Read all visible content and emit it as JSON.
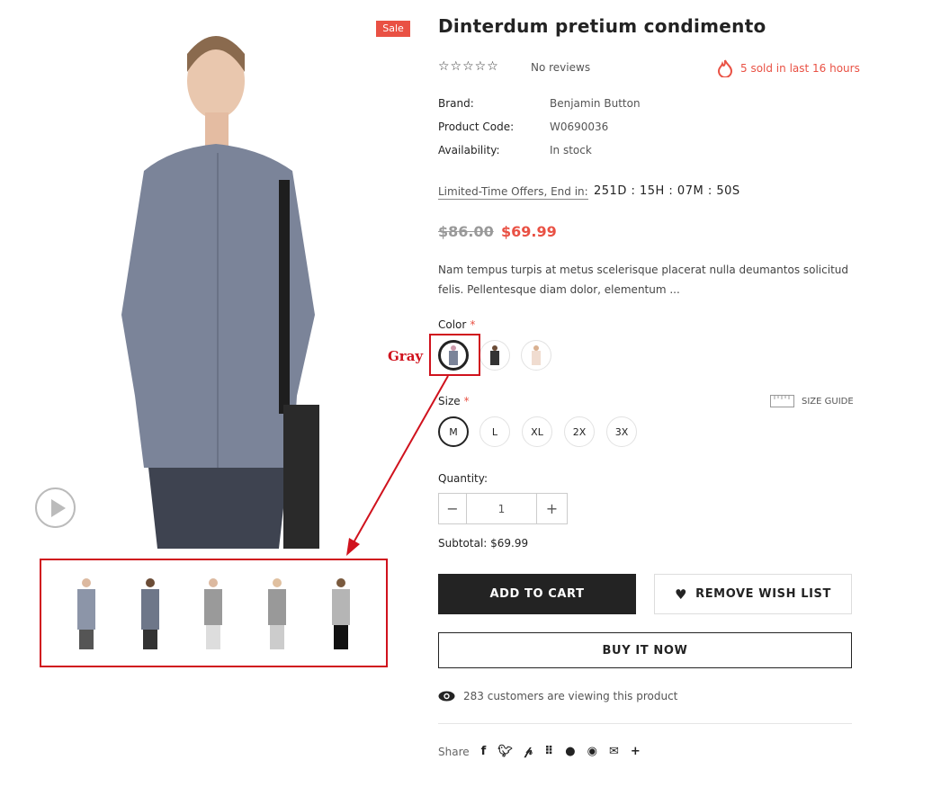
{
  "badge": "Sale",
  "product": {
    "title": "Dinterdum pretium condimento",
    "stars": "☆☆☆☆☆",
    "reviews": "No reviews",
    "sold": "5 sold in last 16 hours",
    "brand_label": "Brand:",
    "brand": "Benjamin Button",
    "code_label": "Product Code:",
    "code": "W0690036",
    "availability_label": "Availability:",
    "availability": "In stock",
    "offer_label": "Limited-Time Offers, End in:",
    "countdown": "251D : 15H : 07M : 50S",
    "old_price": "$86.00",
    "price": "$69.99",
    "description": "Nam tempus turpis at metus scelerisque placerat nulla deumantos solicitud felis. Pellentesque diam dolor, elementum ..."
  },
  "color": {
    "label": "Color",
    "required": "*",
    "selected_annotation": "Gray"
  },
  "size": {
    "label": "Size",
    "required": "*",
    "guide": "SIZE GUIDE",
    "options": [
      "M",
      "L",
      "XL",
      "2X",
      "3X"
    ],
    "selected": "M"
  },
  "quantity": {
    "label": "Quantity:",
    "value": "1",
    "minus": "−",
    "plus": "+"
  },
  "subtotal": {
    "label": "Subtotal:",
    "value": "$69.99"
  },
  "buttons": {
    "add_to_cart": "ADD TO CART",
    "wishlist": "REMOVE WISH LIST",
    "buy_now": "BUY IT NOW"
  },
  "viewers": "283 customers are viewing this product",
  "share": {
    "label": "Share",
    "icons": [
      "facebook-icon",
      "twitter-icon",
      "pinterest-icon",
      "grid-icon",
      "tumblr-icon",
      "messenger-icon",
      "email-icon",
      "plus-icon"
    ]
  },
  "colors": {
    "accent": "#e95144",
    "annotation": "#d0121d",
    "shirt": "#7b8499"
  }
}
